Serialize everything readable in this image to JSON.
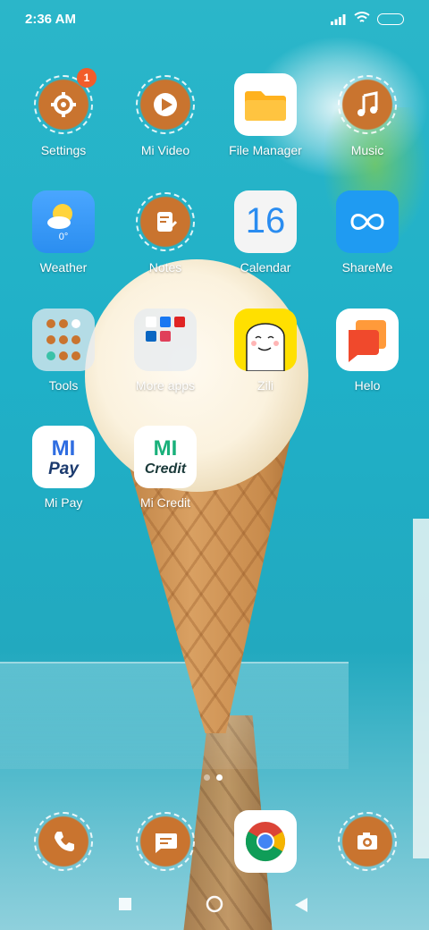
{
  "status_bar": {
    "time": "2:36 AM"
  },
  "apps": {
    "settings": {
      "label": "Settings",
      "badge": "1"
    },
    "mi_video": {
      "label": "Mi Video"
    },
    "file_manager": {
      "label": "File Manager"
    },
    "music": {
      "label": "Music"
    },
    "weather": {
      "label": "Weather",
      "temp": "0°"
    },
    "notes": {
      "label": "Notes"
    },
    "calendar": {
      "label": "Calendar",
      "day": "16"
    },
    "shareme": {
      "label": "ShareMe"
    },
    "tools": {
      "label": "Tools"
    },
    "more_apps": {
      "label": "More apps"
    },
    "zili": {
      "label": "Zili"
    },
    "helo": {
      "label": "Helo"
    },
    "mi_pay": {
      "label": "Mi Pay",
      "logo_top": "MI",
      "logo_bottom": "Pay"
    },
    "mi_credit": {
      "label": "Mi Credit",
      "logo_top": "MI",
      "logo_bottom": "Credit"
    }
  },
  "dock": [
    "phone-icon",
    "messages-icon",
    "chrome-icon",
    "camera-icon"
  ],
  "page_indicator": {
    "pages": 2,
    "current": 2
  },
  "colors": {
    "themed_icon": "#c9742f",
    "badge": "#f25d2a",
    "wallpaper": "#22b0c6"
  }
}
